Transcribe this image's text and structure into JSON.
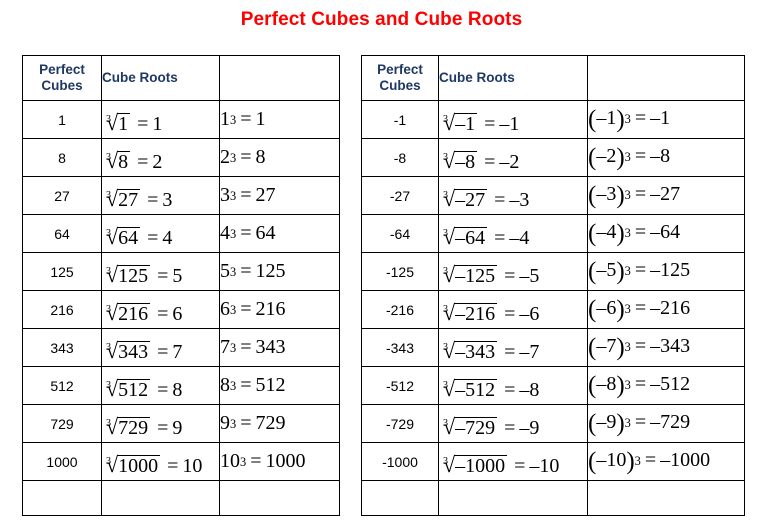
{
  "title": "Perfect Cubes and Cube Roots",
  "title_color": "#ff0000",
  "header_color": "#1f3864",
  "tables": [
    {
      "id": "positive",
      "headers": [
        "Perfect Cubes",
        "Cube Roots",
        ""
      ],
      "header_line1": "Perfect",
      "header_line2": "Cubes",
      "header_roots": "Cube Roots",
      "header_third": "",
      "rows": [
        {
          "value": "1",
          "radicand": "1",
          "root": "1",
          "cube_base": "1",
          "cube_result": "1",
          "root_expr": "∛1 = 1",
          "power_expr": "1³ = 1"
        },
        {
          "value": "8",
          "radicand": "8",
          "root": "2",
          "cube_base": "2",
          "cube_result": "8",
          "root_expr": "∛8 = 2",
          "power_expr": "2³ = 8"
        },
        {
          "value": "27",
          "radicand": "27",
          "root": "3",
          "cube_base": "3",
          "cube_result": "27",
          "root_expr": "∛27 = 3",
          "power_expr": "3³ = 27"
        },
        {
          "value": "64",
          "radicand": "64",
          "root": "4",
          "cube_base": "4",
          "cube_result": "64",
          "root_expr": "∛64 = 4",
          "power_expr": "4³ = 64"
        },
        {
          "value": "125",
          "radicand": "125",
          "root": "5",
          "cube_base": "5",
          "cube_result": "125",
          "root_expr": "∛125 = 5",
          "power_expr": "5³ = 125"
        },
        {
          "value": "216",
          "radicand": "216",
          "root": "6",
          "cube_base": "6",
          "cube_result": "216",
          "root_expr": "∛216 = 6",
          "power_expr": "6³ = 216"
        },
        {
          "value": "343",
          "radicand": "343",
          "root": "7",
          "cube_base": "7",
          "cube_result": "343",
          "root_expr": "∛343 = 7",
          "power_expr": "7³ = 343"
        },
        {
          "value": "512",
          "radicand": "512",
          "root": "8",
          "cube_base": "8",
          "cube_result": "512",
          "root_expr": "∛512 = 8",
          "power_expr": "8³ = 512"
        },
        {
          "value": "729",
          "radicand": "729",
          "root": "9",
          "cube_base": "9",
          "cube_result": "729",
          "root_expr": "∛729 = 9",
          "power_expr": "9³ = 729"
        },
        {
          "value": "1000",
          "radicand": "1000",
          "root": "10",
          "cube_base": "10",
          "cube_result": "1000",
          "root_expr": "∛1000 = 10",
          "power_expr": "10³ = 1000"
        }
      ]
    },
    {
      "id": "negative",
      "headers": [
        "Perfect Cubes",
        "Cube Roots",
        ""
      ],
      "header_line1": "Perfect",
      "header_line2": "Cubes",
      "header_roots": "Cube Roots",
      "header_third": "",
      "rows": [
        {
          "value": "-1",
          "radicand": "–1",
          "root": "–1",
          "cube_base": "–1",
          "cube_result": "–1",
          "root_expr": "∛–1 = –1",
          "power_expr": "(–1)³ = –1"
        },
        {
          "value": "-8",
          "radicand": "–8",
          "root": "–2",
          "cube_base": "–2",
          "cube_result": "–8",
          "root_expr": "∛–8 = –2",
          "power_expr": "(–2)³ = –8"
        },
        {
          "value": "-27",
          "radicand": "–27",
          "root": "–3",
          "cube_base": "–3",
          "cube_result": "–27",
          "root_expr": "∛–27 = –3",
          "power_expr": "(–3)³ = –27"
        },
        {
          "value": "-64",
          "radicand": "–64",
          "root": "–4",
          "cube_base": "–4",
          "cube_result": "–64",
          "root_expr": "∛–64 = –4",
          "power_expr": "(–4)³ = –64"
        },
        {
          "value": "-125",
          "radicand": "–125",
          "root": "–5",
          "cube_base": "–5",
          "cube_result": "–125",
          "root_expr": "∛–125 = –5",
          "power_expr": "(–5)³ = –125"
        },
        {
          "value": "-216",
          "radicand": "–216",
          "root": "–6",
          "cube_base": "–6",
          "cube_result": "–216",
          "root_expr": "∛–216 = –6",
          "power_expr": "(–6)³ = –216"
        },
        {
          "value": "-343",
          "radicand": "–343",
          "root": "–7",
          "cube_base": "–7",
          "cube_result": "–343",
          "root_expr": "∛–343 = –7",
          "power_expr": "(–7)³ = –343"
        },
        {
          "value": "-512",
          "radicand": "–512",
          "root": "–8",
          "cube_base": "–8",
          "cube_result": "–512",
          "root_expr": "∛–512 = –8",
          "power_expr": "(–8)³ = –512"
        },
        {
          "value": "-729",
          "radicand": "–729",
          "root": "–9",
          "cube_base": "–9",
          "cube_result": "–729",
          "root_expr": "∛–729 = –9",
          "power_expr": "(–9)³ = –729"
        },
        {
          "value": "-1000",
          "radicand": "–1000",
          "root": "–10",
          "cube_base": "–10",
          "cube_result": "–1000",
          "root_expr": "∛–1000 = –10",
          "power_expr": "(–10)³ = –1000"
        }
      ]
    }
  ],
  "symbols": {
    "radical_index": "3",
    "radical_sign": "√",
    "equals": "=",
    "exponent": "3",
    "paren_open": "(",
    "paren_close": ")"
  }
}
